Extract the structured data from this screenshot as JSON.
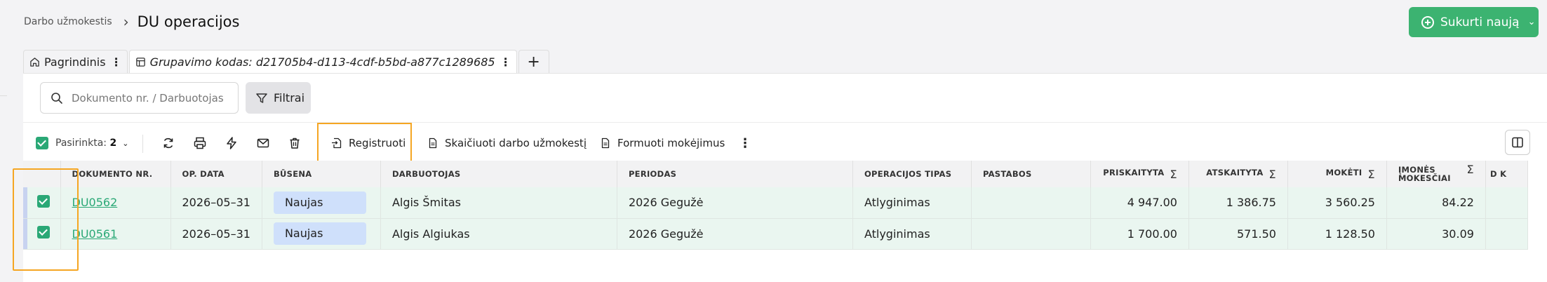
{
  "breadcrumb": {
    "parent": "Darbo užmokestis",
    "current": "DU operacijos"
  },
  "create_button": {
    "label": "Sukurti naują"
  },
  "tabs": [
    {
      "label": "Pagrindinis"
    },
    {
      "label": "Grupavimo kodas: d21705b4-d113-4cdf-b5bd-a877c1289685"
    }
  ],
  "search": {
    "placeholder": "Dokumento nr. / Darbuotojas"
  },
  "filter": {
    "label": "Filtrai"
  },
  "toolbar": {
    "selected_label": "Pasirinkta:",
    "selected_count": "2",
    "register_label": "Registruoti",
    "calculate_label": "Skaičiuoti darbo užmokestį",
    "payments_label": "Formuoti mokėjimus"
  },
  "table": {
    "columns": [
      "DOKUMENTO NR.",
      "OP. DATA",
      "BŪSENA",
      "DARBUOTOJAS",
      "PERIODAS",
      "OPERACIJOS TIPAS",
      "PASTABOS",
      "PRISKAITYTA",
      "ATSKAITYTA",
      "MOKĖTI",
      "ĮMONĖS MOKESČIAI",
      "D K"
    ],
    "rows": [
      {
        "doc": "DU0562",
        "date": "2026–05–31",
        "status": "Naujas",
        "employee": "Algis Šmitas",
        "period": "2026 Gegužė",
        "type": "Atlyginimas",
        "notes": "",
        "accrued": "4 947.00",
        "deducted": "1 386.75",
        "pay": "3 560.25",
        "company_tax": "84.22"
      },
      {
        "doc": "DU0561",
        "date": "2026–05–31",
        "status": "Naujas",
        "employee": "Algis Algiukas",
        "period": "2026 Gegužė",
        "type": "Atlyginimas",
        "notes": "",
        "accrued": "1 700.00",
        "deducted": "571.50",
        "pay": "1 128.50",
        "company_tax": "30.09"
      }
    ]
  },
  "colors": {
    "accent_green": "#3cb371",
    "highlight_orange": "#f5a623",
    "row_selected_bg": "#eaf6f0",
    "badge_bg": "#cfe0fb"
  }
}
